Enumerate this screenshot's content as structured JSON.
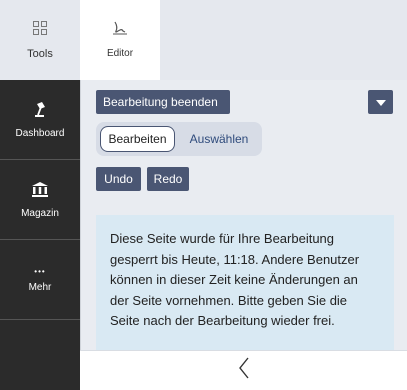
{
  "rail": {
    "tools_label": "Tools",
    "dashboard_label": "Dashboard",
    "magazin_label": "Magazin",
    "more_icon_text": "•••",
    "more_label": "Mehr"
  },
  "tabs": {
    "editor_label": "Editor"
  },
  "editor": {
    "finish_label": "Bearbeitung beenden",
    "mode_edit_label": "Bearbeiten",
    "mode_select_label": "Auswählen",
    "undo_label": "Undo",
    "redo_label": "Redo",
    "info_text": "Diese Seite wurde für Ihre Bearbeitung gesperrt bis Heute, 11:18. Andere Benutzer können in dieser Zeit keine Änderungen an der Seite vornehmen. Bitte geben Sie die Seite nach der Bearbeitung wieder frei."
  },
  "colors": {
    "button": "#4a5673",
    "rail": "#2b2b2b",
    "info_bg": "#d9e9f3"
  }
}
